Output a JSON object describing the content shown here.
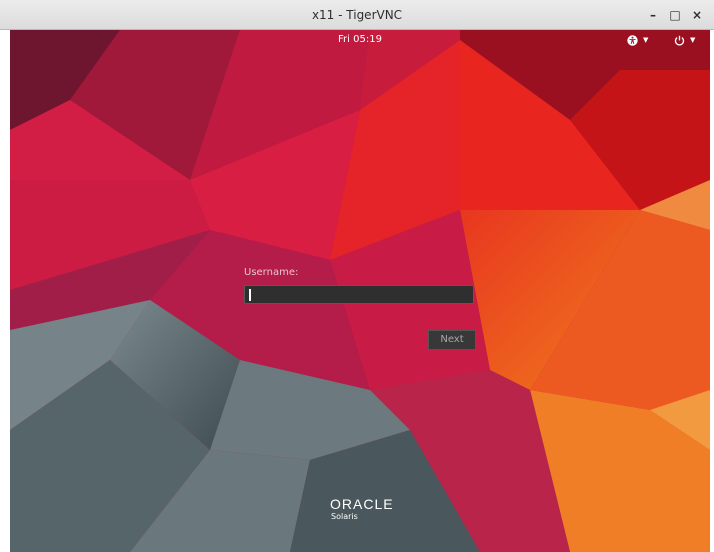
{
  "window": {
    "title": "x11 - TigerVNC",
    "minimize_label": "–",
    "maximize_label": "□",
    "close_label": "×"
  },
  "topbar": {
    "clock": "Fri 05:19",
    "accessibility_icon": "accessibility-icon",
    "power_icon": "power-icon",
    "caret_icon": "chevron-down-icon"
  },
  "login": {
    "username_label": "Username:",
    "username_value": "",
    "next_label": "Next"
  },
  "branding": {
    "company": "ORACLE",
    "product": "Solaris"
  },
  "colors": {
    "background_red": "#c8173a",
    "background_orange": "#e8541e",
    "background_gray": "#5f6e73",
    "input_background": "#2f2f2f"
  }
}
